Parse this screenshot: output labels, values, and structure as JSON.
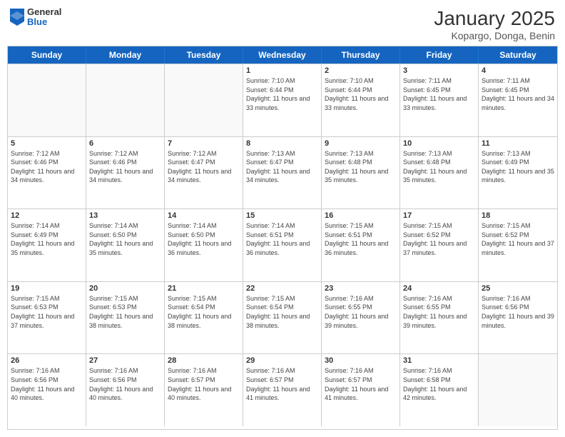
{
  "logo": {
    "general": "General",
    "blue": "Blue"
  },
  "header": {
    "title": "January 2025",
    "subtitle": "Kopargo, Donga, Benin"
  },
  "dayHeaders": [
    "Sunday",
    "Monday",
    "Tuesday",
    "Wednesday",
    "Thursday",
    "Friday",
    "Saturday"
  ],
  "weeks": [
    [
      {
        "num": "",
        "info": ""
      },
      {
        "num": "",
        "info": ""
      },
      {
        "num": "",
        "info": ""
      },
      {
        "num": "1",
        "info": "Sunrise: 7:10 AM\nSunset: 6:44 PM\nDaylight: 11 hours and 33 minutes."
      },
      {
        "num": "2",
        "info": "Sunrise: 7:10 AM\nSunset: 6:44 PM\nDaylight: 11 hours and 33 minutes."
      },
      {
        "num": "3",
        "info": "Sunrise: 7:11 AM\nSunset: 6:45 PM\nDaylight: 11 hours and 33 minutes."
      },
      {
        "num": "4",
        "info": "Sunrise: 7:11 AM\nSunset: 6:45 PM\nDaylight: 11 hours and 34 minutes."
      }
    ],
    [
      {
        "num": "5",
        "info": "Sunrise: 7:12 AM\nSunset: 6:46 PM\nDaylight: 11 hours and 34 minutes."
      },
      {
        "num": "6",
        "info": "Sunrise: 7:12 AM\nSunset: 6:46 PM\nDaylight: 11 hours and 34 minutes."
      },
      {
        "num": "7",
        "info": "Sunrise: 7:12 AM\nSunset: 6:47 PM\nDaylight: 11 hours and 34 minutes."
      },
      {
        "num": "8",
        "info": "Sunrise: 7:13 AM\nSunset: 6:47 PM\nDaylight: 11 hours and 34 minutes."
      },
      {
        "num": "9",
        "info": "Sunrise: 7:13 AM\nSunset: 6:48 PM\nDaylight: 11 hours and 35 minutes."
      },
      {
        "num": "10",
        "info": "Sunrise: 7:13 AM\nSunset: 6:48 PM\nDaylight: 11 hours and 35 minutes."
      },
      {
        "num": "11",
        "info": "Sunrise: 7:13 AM\nSunset: 6:49 PM\nDaylight: 11 hours and 35 minutes."
      }
    ],
    [
      {
        "num": "12",
        "info": "Sunrise: 7:14 AM\nSunset: 6:49 PM\nDaylight: 11 hours and 35 minutes."
      },
      {
        "num": "13",
        "info": "Sunrise: 7:14 AM\nSunset: 6:50 PM\nDaylight: 11 hours and 35 minutes."
      },
      {
        "num": "14",
        "info": "Sunrise: 7:14 AM\nSunset: 6:50 PM\nDaylight: 11 hours and 36 minutes."
      },
      {
        "num": "15",
        "info": "Sunrise: 7:14 AM\nSunset: 6:51 PM\nDaylight: 11 hours and 36 minutes."
      },
      {
        "num": "16",
        "info": "Sunrise: 7:15 AM\nSunset: 6:51 PM\nDaylight: 11 hours and 36 minutes."
      },
      {
        "num": "17",
        "info": "Sunrise: 7:15 AM\nSunset: 6:52 PM\nDaylight: 11 hours and 37 minutes."
      },
      {
        "num": "18",
        "info": "Sunrise: 7:15 AM\nSunset: 6:52 PM\nDaylight: 11 hours and 37 minutes."
      }
    ],
    [
      {
        "num": "19",
        "info": "Sunrise: 7:15 AM\nSunset: 6:53 PM\nDaylight: 11 hours and 37 minutes."
      },
      {
        "num": "20",
        "info": "Sunrise: 7:15 AM\nSunset: 6:53 PM\nDaylight: 11 hours and 38 minutes."
      },
      {
        "num": "21",
        "info": "Sunrise: 7:15 AM\nSunset: 6:54 PM\nDaylight: 11 hours and 38 minutes."
      },
      {
        "num": "22",
        "info": "Sunrise: 7:15 AM\nSunset: 6:54 PM\nDaylight: 11 hours and 38 minutes."
      },
      {
        "num": "23",
        "info": "Sunrise: 7:16 AM\nSunset: 6:55 PM\nDaylight: 11 hours and 39 minutes."
      },
      {
        "num": "24",
        "info": "Sunrise: 7:16 AM\nSunset: 6:55 PM\nDaylight: 11 hours and 39 minutes."
      },
      {
        "num": "25",
        "info": "Sunrise: 7:16 AM\nSunset: 6:56 PM\nDaylight: 11 hours and 39 minutes."
      }
    ],
    [
      {
        "num": "26",
        "info": "Sunrise: 7:16 AM\nSunset: 6:56 PM\nDaylight: 11 hours and 40 minutes."
      },
      {
        "num": "27",
        "info": "Sunrise: 7:16 AM\nSunset: 6:56 PM\nDaylight: 11 hours and 40 minutes."
      },
      {
        "num": "28",
        "info": "Sunrise: 7:16 AM\nSunset: 6:57 PM\nDaylight: 11 hours and 40 minutes."
      },
      {
        "num": "29",
        "info": "Sunrise: 7:16 AM\nSunset: 6:57 PM\nDaylight: 11 hours and 41 minutes."
      },
      {
        "num": "30",
        "info": "Sunrise: 7:16 AM\nSunset: 6:57 PM\nDaylight: 11 hours and 41 minutes."
      },
      {
        "num": "31",
        "info": "Sunrise: 7:16 AM\nSunset: 6:58 PM\nDaylight: 11 hours and 42 minutes."
      },
      {
        "num": "",
        "info": ""
      }
    ]
  ]
}
